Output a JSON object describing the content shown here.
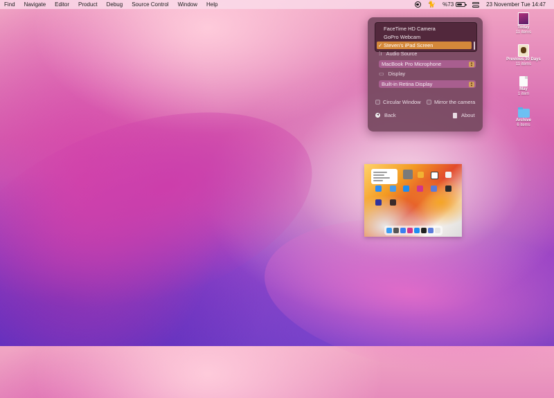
{
  "menubar": {
    "items": [
      "Find",
      "Navigate",
      "Editor",
      "Product",
      "Debug",
      "Source Control",
      "Window",
      "Help"
    ],
    "battery_percent_label": "%73",
    "battery_level": 0.73,
    "datetime": "23 November Tue  14:47",
    "icons": [
      "record-icon",
      "cat-icon",
      "battery-icon",
      "control-center-icon"
    ]
  },
  "panel": {
    "camera_options": [
      "FaceTime HD Camera",
      "GoPro Webcam",
      "Steven's iPad Screen"
    ],
    "selected_camera": "Steven's iPad Screen",
    "check_mark": "✓",
    "audio_label": "Audio Source",
    "audio_value": "MacBook Pro Microphone",
    "display_label": "Display",
    "display_value": "Built-in Retina Display",
    "circular_window_label": "Circular Window",
    "mirror_label": "Mirror the camera",
    "back_label": "Back",
    "about_label": "About"
  },
  "desktop": {
    "items": [
      {
        "name": "Today",
        "count": "11 items",
        "icon": "photo-stack-icon"
      },
      {
        "name": "Previous 30 Days",
        "count": "11 items",
        "icon": "photo-icon"
      },
      {
        "name": "May",
        "count": "1 item",
        "icon": "document-icon"
      },
      {
        "name": "Archive",
        "count": "6 items",
        "icon": "folder-icon"
      }
    ]
  },
  "colors": {
    "selection_orange": "#d4883a",
    "panel_bg": "#764860",
    "select_bg": "#a85e8f"
  }
}
